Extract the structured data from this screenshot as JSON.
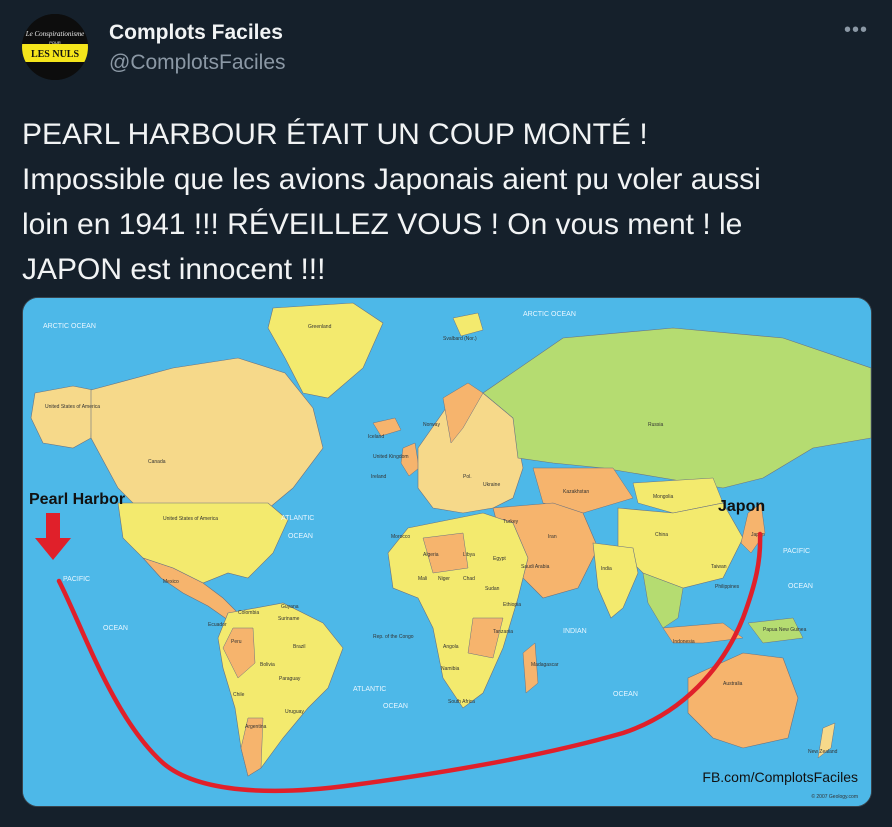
{
  "account": {
    "display_name": "Complots Faciles",
    "handle": "@ComplotsFaciles",
    "avatar_text_top": "Le Conspirationisme",
    "avatar_text_pour": "POUR",
    "avatar_text_main": "LES NULS"
  },
  "more_icon": "more-horizontal-icon",
  "tweet": {
    "lines": [
      "PEARL HARBOUR ÉTAIT UN COUP MONTÉ !",
      "Impossible que les avions Japonais aient pu voler aussi",
      "loin en 1941 !!! RÉVEILLEZ VOUS ! On vous ment ! le",
      "JAPON est innocent !!!"
    ]
  },
  "map": {
    "label_pearl": "Pearl Harbor",
    "label_japon": "Japon",
    "watermark": "FB.com/ComplotsFaciles",
    "copyright": "© 2007 Geology.com",
    "oceans": {
      "arctic_left": "ARCTIC OCEAN",
      "arctic_top": "ARCTIC OCEAN",
      "atlantic_n1": "ATLANTIC",
      "atlantic_n2": "OCEAN",
      "pacific_e1": "PACIFIC",
      "pacific_e2": "OCEAN",
      "pacific_w1": "PACIFIC",
      "pacific_w2": "OCEAN",
      "indian": "INDIAN",
      "atlantic_s1": "ATLANTIC",
      "atlantic_s2": "OCEAN",
      "ocean_se": "OCEAN"
    },
    "countries": {
      "greenland": "Greenland",
      "usa_alaska": "United States of America",
      "canada": "Canada",
      "usa": "United States of America",
      "mexico": "Mexico",
      "brazil": "Brazil",
      "peru": "Peru",
      "bolivia": "Bolivia",
      "paraguay": "Paraguay",
      "argentina": "Argentina",
      "chile": "Chile",
      "uruguay": "Uruguay",
      "colombia": "Colombia",
      "ecuador": "Ecuador",
      "guyana": "Guyana",
      "suriname": "Suriname",
      "iceland": "Iceland",
      "norway": "Norway",
      "uk": "United Kingdom",
      "ireland": "Ireland",
      "russia": "Russia",
      "kazakhstan": "Kazakhstan",
      "mongolia": "Mongolia",
      "china": "China",
      "india": "India",
      "iran": "Iran",
      "turkey": "Turkey",
      "algeria": "Algeria",
      "libya": "Libya",
      "egypt": "Egypt",
      "mali": "Mali",
      "niger": "Niger",
      "chad": "Chad",
      "sudan": "Sudan",
      "ethiopia": "Ethiopia",
      "congo": "Rep. of the Congo",
      "tanzania": "Tanzania",
      "angola": "Angola",
      "namibia": "Namibia",
      "south_africa": "South Africa",
      "madagascar": "Madagascar",
      "australia": "Australia",
      "new_zealand": "New Zealand",
      "japan": "Japan",
      "taiwan": "Taiwan",
      "indonesia": "Indonesia",
      "papua": "Papua New Guinea",
      "philippines": "Philippines",
      "svalbard": "Svalbard (Nor.)",
      "ukraine": "Ukraine",
      "poland": "Pol.",
      "morocco": "Morocco",
      "saudi": "Saudi Arabia"
    }
  }
}
